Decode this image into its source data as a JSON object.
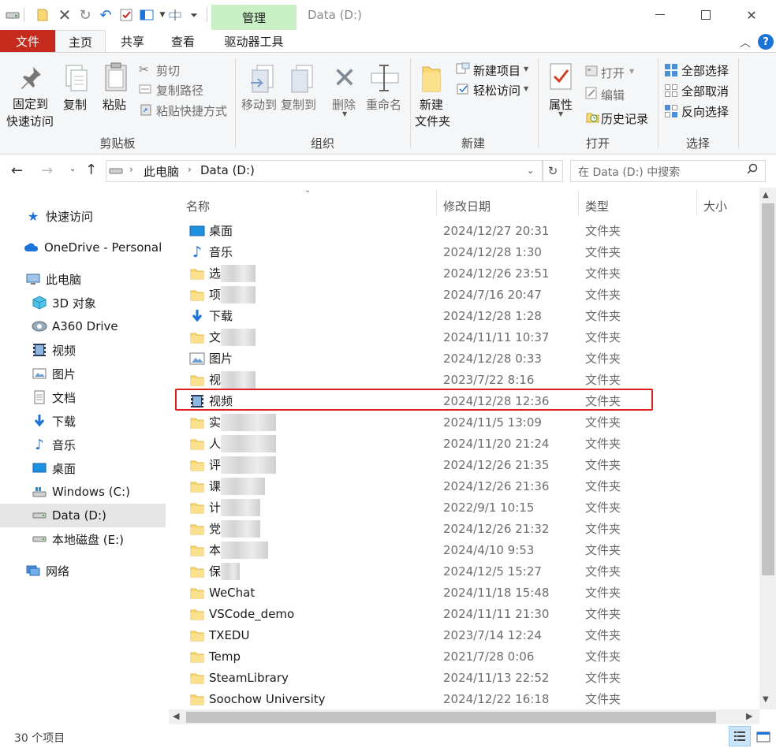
{
  "titlebar": {
    "manage_tab": "管理",
    "title": "Data (D:)"
  },
  "tabs": {
    "file": "文件",
    "home": "主页",
    "share": "共享",
    "view": "查看",
    "drive_tools": "驱动器工具"
  },
  "ribbon": {
    "clipboard": {
      "pin": [
        "固定到",
        "快速访问"
      ],
      "copy": "复制",
      "paste": "粘贴",
      "cut": "剪切",
      "copy_path": "复制路径",
      "paste_shortcut": "粘贴快捷方式",
      "group": "剪贴板"
    },
    "organize": {
      "move_to": "移动到",
      "copy_to": "复制到",
      "delete": "删除",
      "rename": "重命名",
      "group": "组织"
    },
    "new": {
      "new_folder": [
        "新建",
        "文件夹"
      ],
      "new_item": "新建项目",
      "easy_access": "轻松访问",
      "group": "新建"
    },
    "open": {
      "properties": "属性",
      "open": "打开",
      "edit": "编辑",
      "history": "历史记录",
      "group": "打开"
    },
    "select": {
      "select_all": "全部选择",
      "select_none": "全部取消",
      "invert": "反向选择",
      "group": "选择"
    }
  },
  "address": {
    "crumbs": [
      "此电脑",
      "Data (D:)"
    ],
    "search_placeholder": "在 Data (D:) 中搜索"
  },
  "nav": {
    "items": [
      {
        "label": "快速访问",
        "icon": "star-icon"
      },
      {
        "label": "OneDrive - Personal",
        "icon": "cloud-icon"
      },
      {
        "label": "此电脑",
        "icon": "computer-icon"
      },
      {
        "label": "3D 对象",
        "icon": "cube-icon"
      },
      {
        "label": "A360 Drive",
        "icon": "a360-icon"
      },
      {
        "label": "视频",
        "icon": "video-icon"
      },
      {
        "label": "图片",
        "icon": "picture-icon"
      },
      {
        "label": "文档",
        "icon": "document-icon"
      },
      {
        "label": "下载",
        "icon": "download-icon"
      },
      {
        "label": "音乐",
        "icon": "music-icon"
      },
      {
        "label": "桌面",
        "icon": "desktop-icon"
      },
      {
        "label": "Windows (C:)",
        "icon": "windows-drive-icon"
      },
      {
        "label": "Data (D:)",
        "icon": "drive-icon"
      },
      {
        "label": "本地磁盘 (E:)",
        "icon": "drive-icon"
      },
      {
        "label": "网络",
        "icon": "network-icon"
      }
    ]
  },
  "list": {
    "headers": {
      "name": "名称",
      "date": "修改日期",
      "type": "类型",
      "size": "大小"
    },
    "rows": [
      {
        "name": "桌面",
        "date": "2024/12/27 20:31",
        "type": "文件夹",
        "icon": "desktop-icon"
      },
      {
        "name": "音乐",
        "date": "2024/12/28 1:30",
        "type": "文件夹",
        "icon": "music-icon"
      },
      {
        "name": "选",
        "date": "2024/12/26 23:51",
        "type": "文件夹",
        "icon": "folder-icon"
      },
      {
        "name": "项",
        "date": "2024/7/16 20:47",
        "type": "文件夹",
        "icon": "folder-icon"
      },
      {
        "name": "下载",
        "date": "2024/12/28 1:28",
        "type": "文件夹",
        "icon": "download-icon"
      },
      {
        "name": "文",
        "date": "2024/11/11 10:37",
        "type": "文件夹",
        "icon": "folder-icon"
      },
      {
        "name": "图片",
        "date": "2024/12/28 0:33",
        "type": "文件夹",
        "icon": "picture-icon"
      },
      {
        "name": "视",
        "date": "2023/7/22 8:16",
        "type": "文件夹",
        "icon": "folder-icon"
      },
      {
        "name": "视频",
        "date": "2024/12/28 12:36",
        "type": "文件夹",
        "icon": "video-icon"
      },
      {
        "name": "实",
        "date": "2024/11/5 13:09",
        "type": "文件夹",
        "icon": "folder-icon"
      },
      {
        "name": "人",
        "date": "2024/11/20 21:24",
        "type": "文件夹",
        "icon": "folder-icon"
      },
      {
        "name": "评",
        "date": "2024/12/26 21:35",
        "type": "文件夹",
        "icon": "folder-icon"
      },
      {
        "name": "课",
        "date": "2024/12/26 21:36",
        "type": "文件夹",
        "icon": "folder-icon"
      },
      {
        "name": "计",
        "date": "2022/9/1 10:15",
        "type": "文件夹",
        "icon": "folder-icon"
      },
      {
        "name": "党",
        "date": "2024/12/26 21:32",
        "type": "文件夹",
        "icon": "folder-icon"
      },
      {
        "name": "本",
        "date": "2024/4/10 9:53",
        "type": "文件夹",
        "icon": "folder-icon"
      },
      {
        "name": "保",
        "date": "2024/12/5 15:27",
        "type": "文件夹",
        "icon": "folder-icon"
      },
      {
        "name": "WeChat",
        "date": "2024/11/18 15:48",
        "type": "文件夹",
        "icon": "folder-icon"
      },
      {
        "name": "VSCode_demo",
        "date": "2024/11/11 21:30",
        "type": "文件夹",
        "icon": "folder-icon"
      },
      {
        "name": "TXEDU",
        "date": "2023/7/14 12:24",
        "type": "文件夹",
        "icon": "folder-icon"
      },
      {
        "name": "Temp",
        "date": "2021/7/28 0:06",
        "type": "文件夹",
        "icon": "folder-icon"
      },
      {
        "name": "SteamLibrary",
        "date": "2024/11/13 22:52",
        "type": "文件夹",
        "icon": "folder-icon"
      },
      {
        "name": "Soochow University",
        "date": "2024/12/22 16:18",
        "type": "文件夹",
        "icon": "folder-icon"
      }
    ]
  },
  "status": {
    "count": "30 个项目"
  },
  "colors": {
    "file_tab": "#c42b1c",
    "manage_tab": "#c9f0c4",
    "highlight": "#e0201f",
    "folder": "#f8d775",
    "accent": "#1e73d6"
  }
}
